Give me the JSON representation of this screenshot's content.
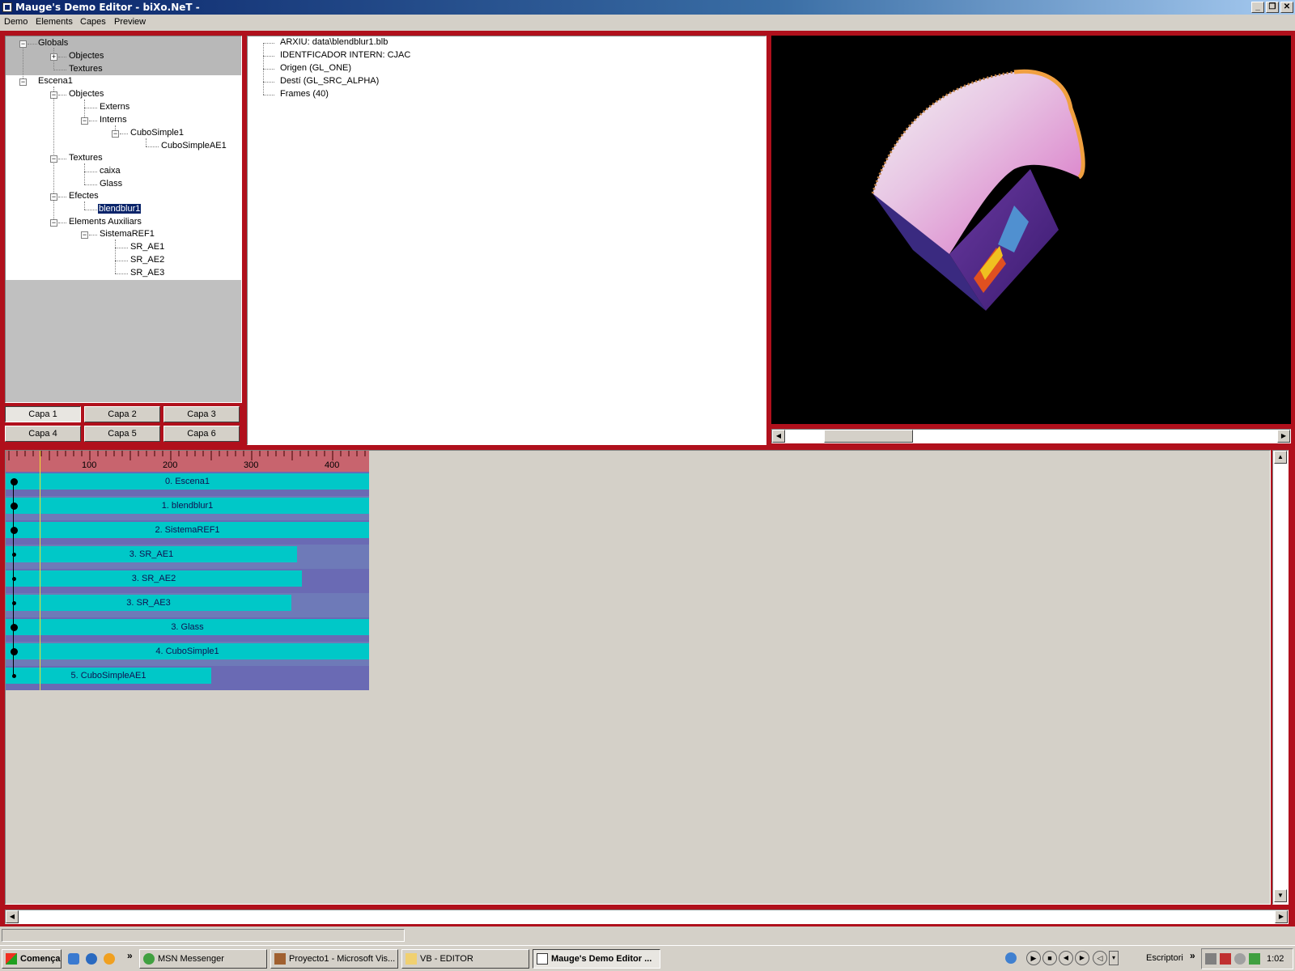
{
  "window": {
    "title": "Mauge's Demo Editor - biXo.NeT -",
    "controls": [
      "_",
      "❐",
      "✕"
    ]
  },
  "menu": [
    "Demo",
    "Elements",
    "Capes",
    "Preview"
  ],
  "tree": {
    "globals": "Globals",
    "objectes_g": "Objectes",
    "textures_g": "Textures",
    "escena": "Escena1",
    "objectes": "Objectes",
    "externs": "Externs",
    "interns": "Interns",
    "cubo": "CuboSimple1",
    "cuboae": "CuboSimpleAE1",
    "textures": "Textures",
    "caixa": "caixa",
    "glass": "Glass",
    "efectes": "Efectes",
    "blend": "blendblur1",
    "aux": "Elements Auxiliars",
    "sistema": "SistemaREF1",
    "sr1": "SR_AE1",
    "sr2": "SR_AE2",
    "sr3": "SR_AE3"
  },
  "layers": [
    "Capa 1",
    "Capa 2",
    "Capa 3",
    "Capa 4",
    "Capa 5",
    "Capa 6"
  ],
  "properties": [
    "ARXIU: data\\blendblur1.blb",
    "IDENTFICADOR INTERN: CJAC",
    "Origen (GL_ONE)",
    "Destí (GL_SRC_ALPHA)",
    "Frames (40)"
  ],
  "timeline": {
    "ruler_labels": [
      "100",
      "200",
      "300",
      "400"
    ],
    "tracks": [
      {
        "label": "0. Escena1",
        "end": 449
      },
      {
        "label": "1. blendblur1",
        "end": 449
      },
      {
        "label": "2. SistemaREF1",
        "end": 449
      },
      {
        "label": "3. SR_AE1",
        "end": 360
      },
      {
        "label": "3. SR_AE2",
        "end": 366
      },
      {
        "label": "3. SR_AE3",
        "end": 353
      },
      {
        "label": "3. Glass",
        "end": 449
      },
      {
        "label": "4. CuboSimple1",
        "end": 449
      },
      {
        "label": "5. CuboSimpleAE1",
        "end": 254
      }
    ]
  },
  "taskbar": {
    "start": "Comença",
    "buttons": [
      "MSN Messenger",
      "Proyecto1 - Microsoft Vis...",
      "VB - EDITOR",
      "Mauge's Demo Editor ..."
    ],
    "desktop_label": "Escriptori",
    "clock": "1:02"
  },
  "colors": {
    "frame": "#b0101c",
    "track": "#00c8c8",
    "track_bg": "#6a6ab4",
    "ruler": "#c8646e"
  }
}
